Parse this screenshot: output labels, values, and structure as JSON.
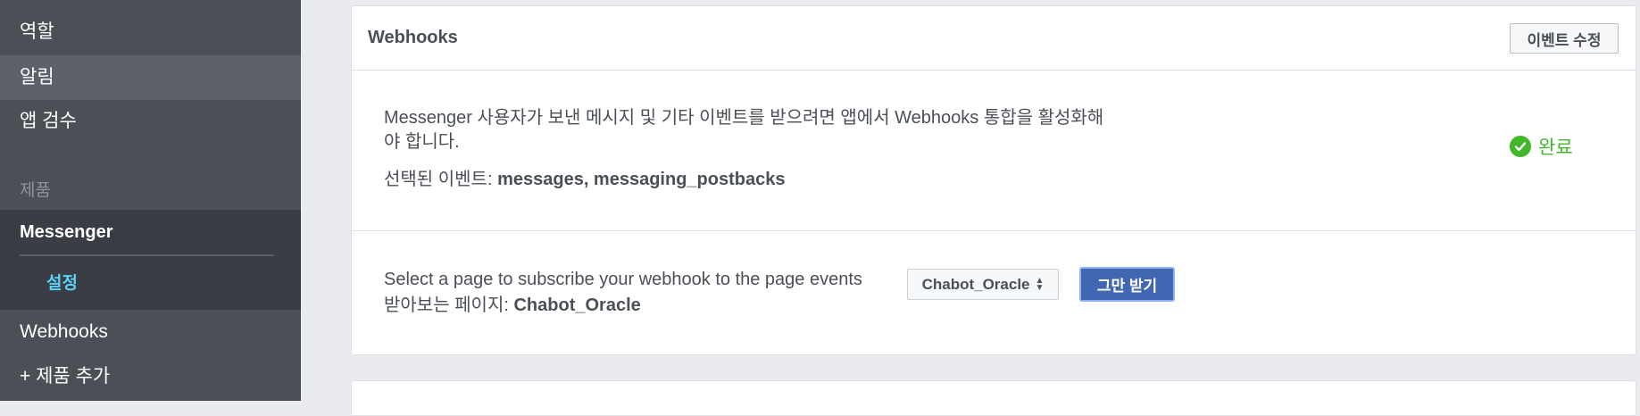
{
  "sidebar": {
    "items_top": [
      {
        "label": "역할"
      },
      {
        "label": "알림"
      },
      {
        "label": "앱 검수"
      }
    ],
    "section_label": "제품",
    "product": "Messenger",
    "product_sub": "설정",
    "items_bottom": [
      {
        "label": "Webhooks"
      },
      {
        "label": "+ 제품 추가"
      }
    ]
  },
  "card": {
    "title": "Webhooks",
    "edit_button": "이벤트 수정",
    "description_line1": "Messenger 사용자가 보낸 메시지 및 기타 이벤트를 받으려면 앱에서 Webhooks 통합을 활성화해",
    "description_line2": "야 합니다.",
    "selected_events_label": "선택된 이벤트: ",
    "selected_events_value": "messages, messaging_postbacks",
    "status_text": "완료",
    "subscribe_instruction": "Select a page to subscribe your webhook to the page events",
    "subscribed_label": "받아보는 페이지: ",
    "subscribed_page": "Chabot_Oracle",
    "page_select_value": "Chabot_Oracle",
    "unsubscribe_button": "그만 받기"
  },
  "colors": {
    "sidebar_bg": "#4b4f56",
    "sidebar_active": "#5d6169",
    "sidebar_product_bg": "#3a3d43",
    "accent_blue": "#4267b2",
    "success_green": "#42b72a",
    "sub_link": "#5ad2f4"
  },
  "icons": {
    "status": "check-circle-icon",
    "select": "updown-arrows-icon"
  }
}
